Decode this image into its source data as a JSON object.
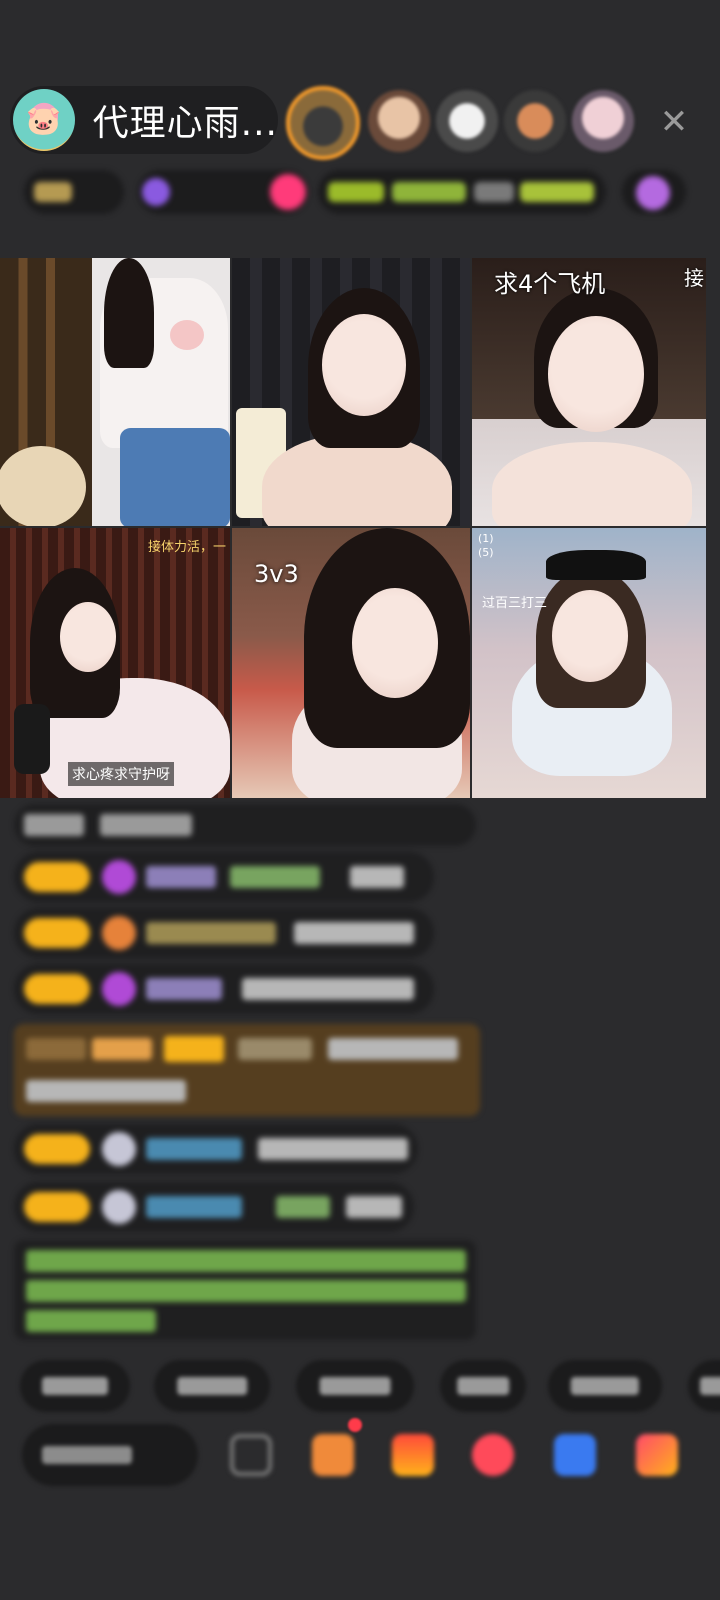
{
  "room": {
    "host_name": "代理心雨...",
    "avatar_icon": "pig-icon",
    "close_icon": "close-icon",
    "close_glyph": "✕"
  },
  "grid": {
    "cells": [
      {
        "labels": []
      },
      {
        "labels": []
      },
      {
        "labels": [
          "求4个飞机",
          "接"
        ]
      },
      {
        "labels": [
          "接体力活，一",
          "求心疼求守护呀"
        ]
      },
      {
        "labels": [
          "3v3"
        ]
      },
      {
        "labels": [
          "(1)",
          "(5)",
          "过百三打三"
        ]
      }
    ]
  },
  "colors": {
    "background": "#2b2b2d",
    "badge_yellow": "#f5b21b",
    "gift_bg": "#784e14",
    "accent_orange": "#f39a2b",
    "medal_purple": "#b04ad6",
    "notify_red": "#ff3b4a"
  }
}
